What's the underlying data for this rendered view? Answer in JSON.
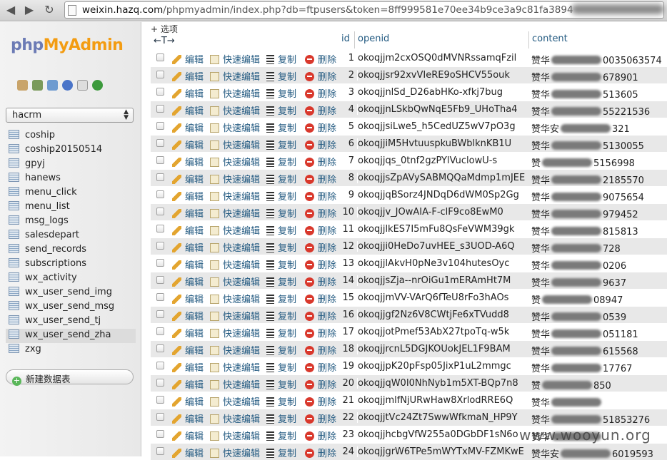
{
  "browser": {
    "url_host": "weixin.hazq.com",
    "url_path": "/phpmyadmin/index.php?db=ftpusers&token=8ff999581e70ee34b9ce3a9c81fa3894"
  },
  "sidebar": {
    "logo_prefix": "php",
    "logo_suffix": "MyAdmin",
    "db_selected": "hacrm",
    "tables": [
      "coship",
      "coship20150514",
      "gpyj",
      "hanews",
      "menu_click",
      "menu_list",
      "msg_logs",
      "salesdepart",
      "send_records",
      "subscriptions",
      "wx_activity",
      "wx_user_send_img",
      "wx_user_send_msg",
      "wx_user_send_tj",
      "wx_user_send_zha",
      "zxg"
    ],
    "new_table_label": "新建数据表",
    "toolbar_icons": [
      "home-icon",
      "exit-icon",
      "query-window-icon",
      "docs-icon",
      "sql-docs-icon",
      "reload-icon"
    ]
  },
  "main": {
    "options_label": "+ 选项",
    "arrows_label": "←T→",
    "columns": {
      "id": "id",
      "openid": "openid",
      "content": "content"
    },
    "actions": {
      "edit": "编辑",
      "quick_edit": "快速编辑",
      "copy": "复制",
      "delete": "删除"
    },
    "rows": [
      {
        "id": "1",
        "openid": "okoqjjm2cxOSQ0dMVNRssamqFzil",
        "content_pre": "赞华",
        "content_post": "0035063574"
      },
      {
        "id": "2",
        "openid": "okoqjjsr92xvVIeRE9oSHCV55ouk",
        "content_pre": "赞华",
        "content_post": "678901"
      },
      {
        "id": "3",
        "openid": "okoqjjnlSd_D26abHKo-xfkj7bug",
        "content_pre": "赞华",
        "content_post": "513605"
      },
      {
        "id": "4",
        "openid": "okoqjjnLSkbQwNqE5Fb9_UHoTha4",
        "content_pre": "赞华",
        "content_post": "55221536"
      },
      {
        "id": "5",
        "openid": "okoqjjsiLwe5_h5CedUZ5wV7pO3g",
        "content_pre": "赞华安",
        "content_post": "321"
      },
      {
        "id": "6",
        "openid": "okoqjjiM5HvtuuspkuBWblknKB1U",
        "content_pre": "赞华",
        "content_post": "5130055"
      },
      {
        "id": "7",
        "openid": "okoqjjqs_0tnf2gzPYlVuclowU-s",
        "content_pre": "赞",
        "content_post": "5156998"
      },
      {
        "id": "8",
        "openid": "okoqjjsZpAVySABMQQaMdmp1mJEE",
        "content_pre": "赞华",
        "content_post": "2185570"
      },
      {
        "id": "9",
        "openid": "okoqjjqBSorz4JNDqD6dWM0Sp2Gg",
        "content_pre": "赞华",
        "content_post": "9075654"
      },
      {
        "id": "10",
        "openid": "okoqjjv_JOwAIA-F-clF9co8EwM0",
        "content_pre": "赞华",
        "content_post": "979452"
      },
      {
        "id": "11",
        "openid": "okoqjjlkES7I5mFu8QsFeVWM39gk",
        "content_pre": "赞华",
        "content_post": "815813"
      },
      {
        "id": "12",
        "openid": "okoqjji0HeDo7uvHEE_s3UOD-A6Q",
        "content_pre": "赞华",
        "content_post": "728"
      },
      {
        "id": "13",
        "openid": "okoqjjlAkvH0pNe3v104hutesOyc",
        "content_pre": "赞华",
        "content_post": "0206"
      },
      {
        "id": "14",
        "openid": "okoqjjsZja--nrOiGu1mERAmHt7M",
        "content_pre": "赞华",
        "content_post": "9637"
      },
      {
        "id": "15",
        "openid": "okoqjjmVV-VArQ6fTeU8rFo3hAOs",
        "content_pre": "赞",
        "content_post": "08947"
      },
      {
        "id": "16",
        "openid": "okoqjjgf2Nz6V8CWtjFe6xTVudd8",
        "content_pre": "赞华",
        "content_post": "0539"
      },
      {
        "id": "17",
        "openid": "okoqjjotPmef53AbX27tpoTq-w5k",
        "content_pre": "赞华",
        "content_post": "051181"
      },
      {
        "id": "18",
        "openid": "okoqjjrcnL5DGJKOUokJEL1F9BAM",
        "content_pre": "赞华",
        "content_post": "615568"
      },
      {
        "id": "19",
        "openid": "okoqjjpK20pFsp05JixP1uL2mmgc",
        "content_pre": "赞华",
        "content_post": "17767"
      },
      {
        "id": "20",
        "openid": "okoqjjqW0I0NhNyb1m5XT-BQp7n8",
        "content_pre": "赞",
        "content_post": "850"
      },
      {
        "id": "21",
        "openid": "okoqjjmlfNjURwHaw8XrlodRRE6Q",
        "content_pre": "赞华",
        "content_post": ""
      },
      {
        "id": "22",
        "openid": "okoqjjtVc24Zt7SwwWfkmaN_HP9Y",
        "content_pre": "赞华",
        "content_post": "51853276"
      },
      {
        "id": "23",
        "openid": "okoqjjhcbgVfW255a0DGbDF1sN6o",
        "content_pre": "赞华",
        "content_post": ""
      },
      {
        "id": "24",
        "openid": "okoqjjgrW6TPe5mWYTxMV-FZMKwE",
        "content_pre": "赞华安",
        "content_post": "6019593"
      }
    ]
  },
  "watermark": "www.wooyun.org"
}
